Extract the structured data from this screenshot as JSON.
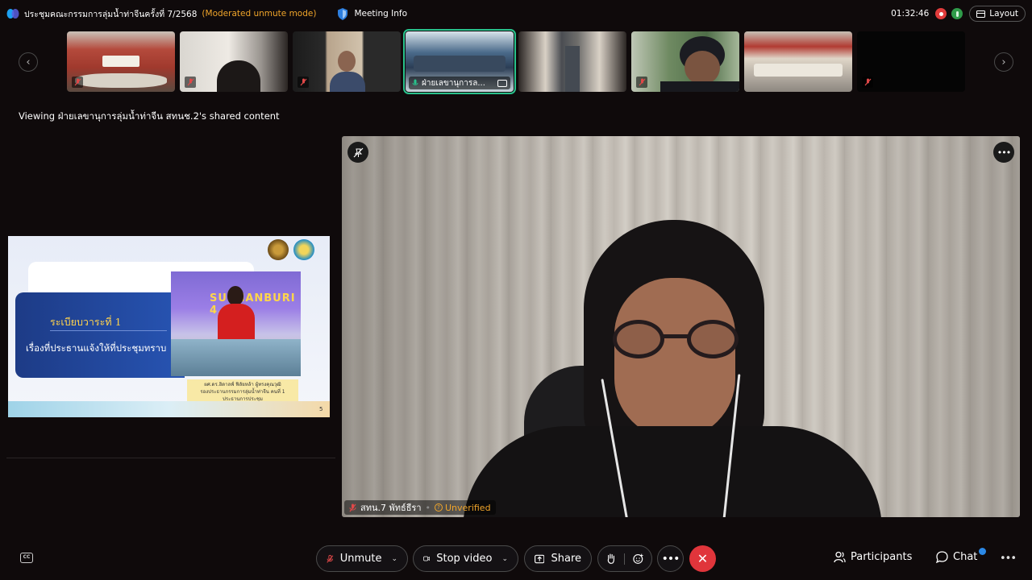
{
  "header": {
    "meeting_title": "ประชุมคณะกรรมการลุ่มน้ำท่าจีนครั้งที่ 7/2568",
    "mode": "(Moderated unmute mode)",
    "meeting_info": "Meeting Info",
    "timer": "01:32:46",
    "layout": "Layout"
  },
  "thumbnails": [
    {
      "id": "t1",
      "muted": true
    },
    {
      "id": "t2",
      "muted": true
    },
    {
      "id": "t3",
      "muted": true
    },
    {
      "id": "t4",
      "label": "ฝ่ายเลขานุการล...",
      "active": true
    },
    {
      "id": "t5",
      "muted": false
    },
    {
      "id": "t6",
      "muted": true
    },
    {
      "id": "t7",
      "muted": false
    },
    {
      "id": "t8",
      "muted": true
    }
  ],
  "viewing_label": "Viewing ฝ่ายเลขานุการลุ่มน้ำท่าจีน สทนช.2's shared content",
  "slide": {
    "heading": "ระเบียบวาระที่ 1",
    "subheading": "เรื่องที่ประธานแจ้งให้ที่ประชุมทราบ",
    "photo_text": "SUPHANBURI 4.0",
    "caption_line1": "ผศ.ดร.ฮิดาลฟ์ ฟิลัยหล้า ผู้ทรงคุณวุฒิ",
    "caption_line2": "รองประธานกรรมการลุ่มน้ำท่าจีน คนที่ 1",
    "caption_line3": "ประธานการประชุม",
    "page_number": "5"
  },
  "main_video": {
    "name": "สทน.7 พัทธ์ธีรา",
    "status": "Unverified"
  },
  "toolbar": {
    "unmute": "Unmute",
    "stop_video": "Stop video",
    "share": "Share",
    "participants": "Participants",
    "chat": "Chat"
  },
  "colors": {
    "accent_orange": "#f0a52a",
    "end_call_red": "#e0353b",
    "active_border": "#28c28c",
    "notify_blue": "#2b88e6"
  }
}
